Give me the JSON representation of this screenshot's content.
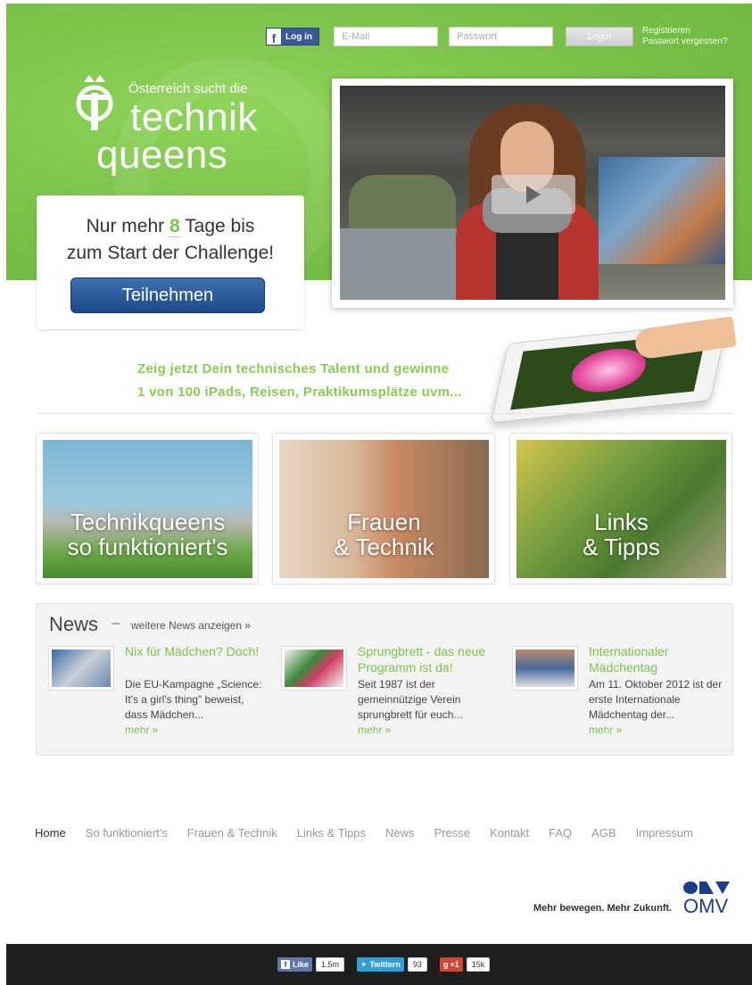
{
  "header": {
    "fb_login_label": "Log in",
    "email_placeholder": "E-Mail",
    "password_placeholder": "Passwort",
    "login_button": "Login",
    "register_link": "Registrieren",
    "forgot_link": "Passwort vergessen?"
  },
  "logo": {
    "subtitle": "Österreich sucht die",
    "line1": "technik",
    "line2": "queens"
  },
  "countdown": {
    "prefix": "Nur mehr",
    "days": "8",
    "suffix": "Tage bis",
    "line2": "zum Start der Challenge!",
    "button": "Teilnehmen"
  },
  "promo": {
    "line1": "Zeig jetzt Dein technisches Talent und gewinne",
    "line2": "1 von 100 iPads, Reisen, Praktikumsplätze uvm..."
  },
  "tiles": [
    {
      "line1": "Technikqueens",
      "line2": "so funktioniert's"
    },
    {
      "line1": "Frauen",
      "line2": "& Technik"
    },
    {
      "line1": "Links",
      "line2": "& Tipps"
    }
  ],
  "news": {
    "title": "News",
    "dash": "–",
    "more_link": "weitere News anzeigen »",
    "items": [
      {
        "headline": "Nix für Mädchen? Doch!",
        "body": "Die EU-Kampagne „Science: It's a girl's thing\" beweist, dass Mädchen...",
        "more": "mehr »"
      },
      {
        "headline": "Sprungbrett - das neue Programm ist da!",
        "body": "Seit 1987 ist der gemeinnützige Verein sprungbrett für euch...",
        "more": "mehr »"
      },
      {
        "headline": "Internationaler Mädchentag",
        "body": "Am 11. Oktober 2012 ist der erste Internationale Mädchentag der...",
        "more": "mehr »"
      }
    ]
  },
  "footer_nav": [
    "Home",
    "So funktioniert's",
    "Frauen & Technik",
    "Links & Tipps",
    "News",
    "Presse",
    "Kontakt",
    "FAQ",
    "AGB",
    "Impressum"
  ],
  "omv": {
    "slogan": "Mehr bewegen. Mehr Zukunft.",
    "brand": "OMV"
  },
  "social": {
    "like_label": "Like",
    "like_count": "1.5m",
    "twitter_label": "Twittern",
    "twitter_count": "93",
    "gplus_label": "+1",
    "gplus_count": "15k"
  },
  "colors": {
    "accent_green": "#7cc34b",
    "button_blue": "#1d4a8a",
    "facebook": "#3b5998"
  }
}
